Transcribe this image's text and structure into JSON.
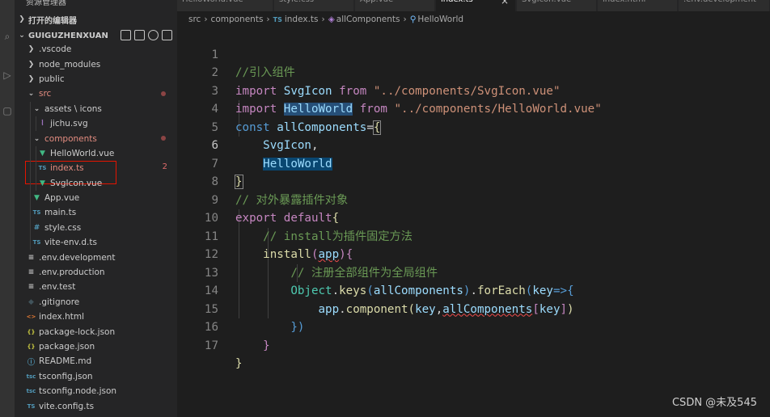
{
  "sidebar": {
    "title": "资源管理器",
    "open_editors": "打开的编辑器",
    "root": "GUIGUZHENXUAN",
    "items": [
      {
        "label": ".vscode",
        "type": "folder-collapsed",
        "indent": 0
      },
      {
        "label": "node_modules",
        "type": "folder-collapsed",
        "indent": 0
      },
      {
        "label": "public",
        "type": "folder-collapsed",
        "indent": 0
      },
      {
        "label": "src",
        "type": "folder-open",
        "indent": 0,
        "modified": true
      },
      {
        "label": "assets \\ icons",
        "type": "folder-open",
        "indent": 1
      },
      {
        "label": "jichu.svg",
        "type": "svg",
        "indent": 2
      },
      {
        "label": "components",
        "type": "folder-open",
        "indent": 1,
        "modified": true
      },
      {
        "label": "HelloWorld.vue",
        "type": "vue",
        "indent": 2
      },
      {
        "label": "index.ts",
        "type": "ts",
        "indent": 2,
        "badge": "2",
        "selected": true
      },
      {
        "label": "SvgIcon.vue",
        "type": "vue",
        "indent": 2
      },
      {
        "label": "App.vue",
        "type": "vue",
        "indent": 1
      },
      {
        "label": "main.ts",
        "type": "ts",
        "indent": 1
      },
      {
        "label": "style.css",
        "type": "css",
        "indent": 1
      },
      {
        "label": "vite-env.d.ts",
        "type": "ts",
        "indent": 1
      },
      {
        "label": ".env.development",
        "type": "env",
        "indent": 0
      },
      {
        "label": ".env.production",
        "type": "env",
        "indent": 0
      },
      {
        "label": ".env.test",
        "type": "env",
        "indent": 0
      },
      {
        "label": ".gitignore",
        "type": "git",
        "indent": 0
      },
      {
        "label": "index.html",
        "type": "html",
        "indent": 0
      },
      {
        "label": "package-lock.json",
        "type": "json",
        "indent": 0
      },
      {
        "label": "package.json",
        "type": "json",
        "indent": 0
      },
      {
        "label": "README.md",
        "type": "md",
        "indent": 0
      },
      {
        "label": "tsconfig.json",
        "type": "tsconfig",
        "indent": 0
      },
      {
        "label": "tsconfig.node.json",
        "type": "tsconfig",
        "indent": 0
      },
      {
        "label": "vite.config.ts",
        "type": "ts",
        "indent": 0
      }
    ]
  },
  "tabs": [
    {
      "label": "HelloWorld.vue"
    },
    {
      "label": "style.css"
    },
    {
      "label": "App.vue"
    },
    {
      "label": "index.ts",
      "active": true
    },
    {
      "label": "SvgIcon.vue"
    },
    {
      "label": "index.html"
    },
    {
      "label": ".env.development"
    }
  ],
  "breadcrumb": {
    "src": "src",
    "components": "components",
    "file_badge": "TS",
    "file": "index.ts",
    "symbol1": "allComponents",
    "symbol2": "HelloWorld"
  },
  "editor": {
    "current_line": 6,
    "line_numbers": [
      "1",
      "2",
      "3",
      "4",
      "5",
      "6",
      "7",
      "8",
      "9",
      "10",
      "11",
      "12",
      "13",
      "14",
      "15",
      "16",
      "17"
    ]
  },
  "watermark": "CSDN @未及545",
  "colors": {
    "editor_bg": "#1e1e1e",
    "sidebar_bg": "#252526",
    "keyword": "#569cd6",
    "string": "#ce9178",
    "comment": "#6a9955",
    "variable": "#9cdcfe",
    "function": "#dcdcaa"
  }
}
